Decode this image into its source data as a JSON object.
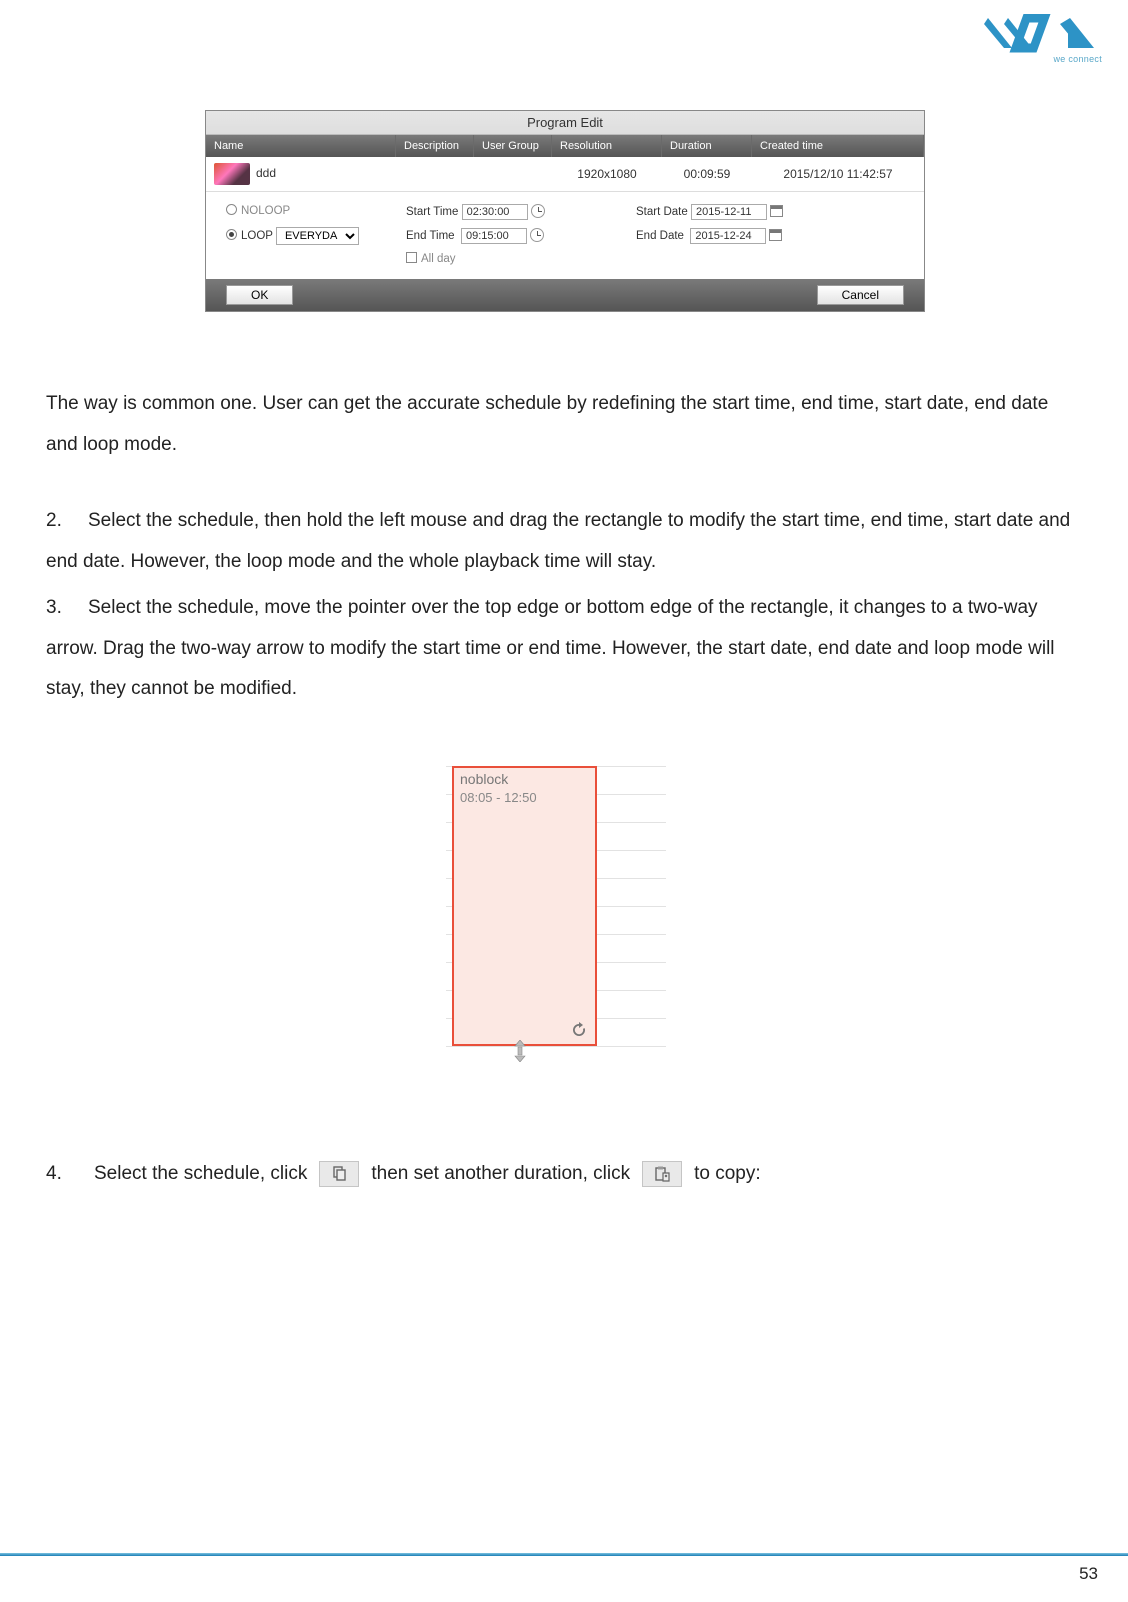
{
  "logo_tagline": "we connect",
  "page_number": "53",
  "dlg": {
    "title": "Program Edit",
    "headers": {
      "name": "Name",
      "desc": "Description",
      "ug": "User Group",
      "res": "Resolution",
      "dur": "Duration",
      "created": "Created time"
    },
    "row": {
      "name": "ddd",
      "res": "1920x1080",
      "dur": "00:09:59",
      "created": "2015/12/10 11:42:57"
    },
    "noloop": "NOLOOP",
    "loop": "LOOP",
    "loop_sel": "EVERYDA",
    "start_time_lbl": "Start Time",
    "start_time": "02:30:00",
    "end_time_lbl": "End Time",
    "end_time": "09:15:00",
    "allday": "All day",
    "start_date_lbl": "Start Date",
    "start_date": "2015-12-11",
    "end_date_lbl": "End Date",
    "end_date": "2015-12-24",
    "ok": "OK",
    "cancel": "Cancel"
  },
  "para1": "The way is common one. User can get the accurate schedule by redefining the start time, end time, start date, end date and loop mode.",
  "para2_num": "2.",
  "para2": "Select the schedule, then hold the left mouse and drag the rectangle to modify the start time, end time, start date and end date. However, the loop mode and the whole playback time will stay.",
  "para3_num": "3.",
  "para3": "Select the schedule, move the pointer over the top edge or bottom edge of the rectangle, it changes to a two-way arrow. Drag the two-way arrow to modify the start time or end time. However, the start date, end date and loop mode will stay, they cannot be modified.",
  "shot2": {
    "label": "noblock",
    "time": "08:05 - 12:50"
  },
  "para4_num": "4.",
  "para4a": "Select the schedule, click",
  "para4b": "then set another duration, click",
  "para4c": "to copy:"
}
